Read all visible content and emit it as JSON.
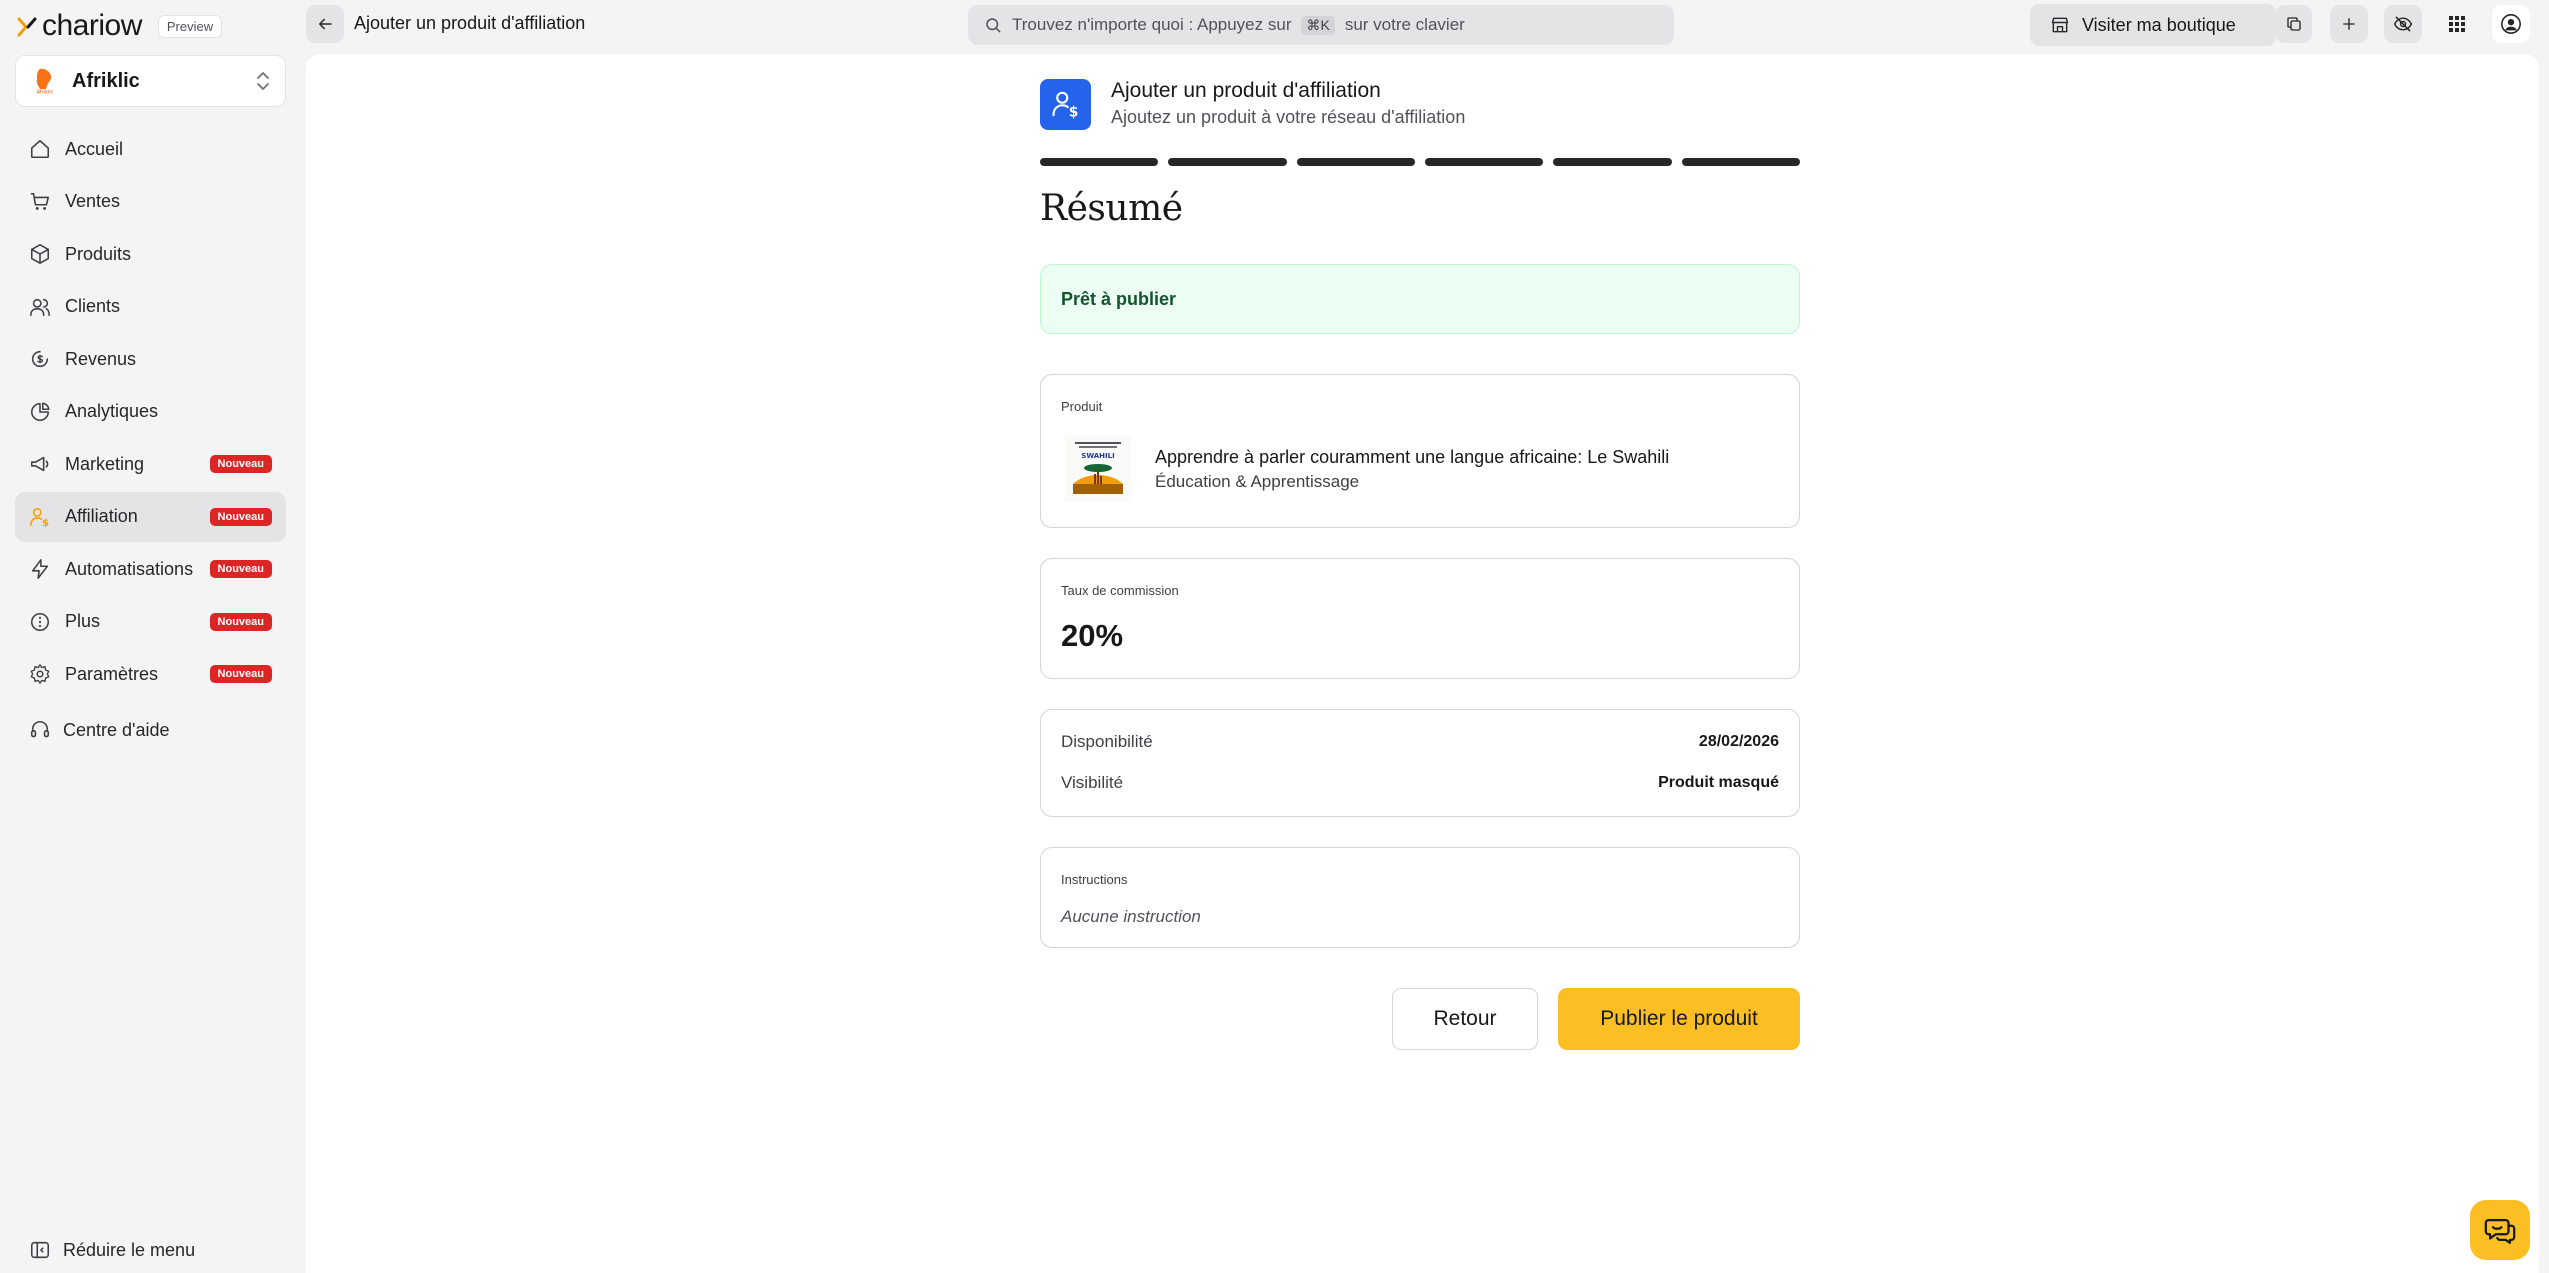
{
  "brand": {
    "name": "chariow",
    "preview_label": "Preview"
  },
  "store": {
    "name": "Afriklic"
  },
  "sidebar": {
    "items": [
      {
        "label": "Accueil",
        "icon": "home-icon",
        "badge": ""
      },
      {
        "label": "Ventes",
        "icon": "cart-icon",
        "badge": ""
      },
      {
        "label": "Produits",
        "icon": "box-icon",
        "badge": ""
      },
      {
        "label": "Clients",
        "icon": "users-icon",
        "badge": ""
      },
      {
        "label": "Revenus",
        "icon": "revenue-icon",
        "badge": ""
      },
      {
        "label": "Analytiques",
        "icon": "analytics-icon",
        "badge": ""
      },
      {
        "label": "Marketing",
        "icon": "megaphone-icon",
        "badge": "Nouveau"
      },
      {
        "label": "Affiliation",
        "icon": "affiliate-icon",
        "badge": "Nouveau"
      },
      {
        "label": "Automatisations",
        "icon": "bolt-icon",
        "badge": "Nouveau"
      },
      {
        "label": "Plus",
        "icon": "more-icon",
        "badge": "Nouveau"
      },
      {
        "label": "Paramètres",
        "icon": "gear-icon",
        "badge": "Nouveau"
      }
    ],
    "help_label": "Centre d'aide",
    "collapse_label": "Réduire le menu"
  },
  "topbar": {
    "page_title": "Ajouter un produit d'affiliation",
    "search_prefix": "Trouvez n'importe quoi : Appuyez sur",
    "search_kbd": "⌘K",
    "search_suffix": "sur votre clavier",
    "visit_label": "Visiter ma boutique"
  },
  "main": {
    "header_title": "Ajouter un produit d'affiliation",
    "header_subtitle": "Ajoutez un produit à votre réseau d'affiliation",
    "steps_total": 6,
    "steps_completed": 6,
    "section_title": "Résumé",
    "ready_text": "Prêt à publier",
    "product": {
      "label": "Produit",
      "name": "Apprendre à parler couramment une langue africaine: Le Swahili",
      "category": "Éducation & Apprentissage",
      "thumb_text": "SWAHILI"
    },
    "commission": {
      "label": "Taux de commission",
      "value": "20%"
    },
    "availability": {
      "label": "Disponibilité",
      "value": "28/02/2026"
    },
    "visibility": {
      "label": "Visibilité",
      "value": "Produit masqué"
    },
    "instructions": {
      "label": "Instructions",
      "value": "Aucune instruction"
    },
    "back_label": "Retour",
    "publish_label": "Publier le produit"
  },
  "colors": {
    "accent": "#fbbf24",
    "primary_blue": "#2563eb",
    "badge_red": "#dc2626",
    "success_bg": "#ecfdf3"
  }
}
